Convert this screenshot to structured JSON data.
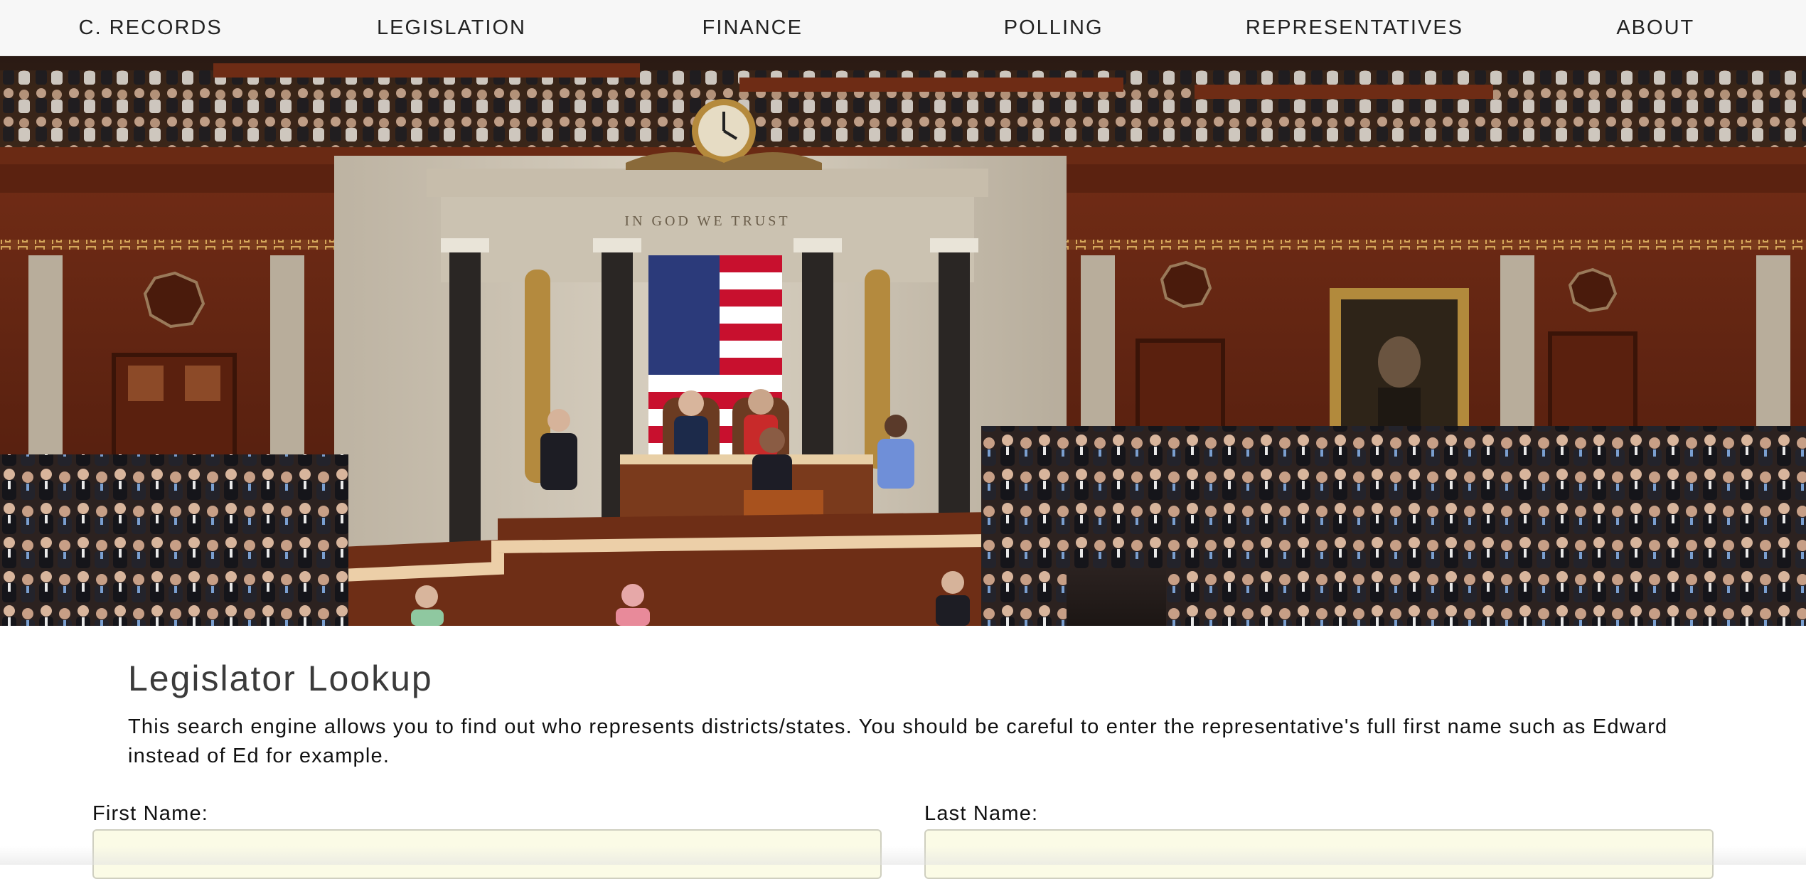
{
  "nav": {
    "items": [
      {
        "label": "C. RECORDS"
      },
      {
        "label": "LEGISLATION"
      },
      {
        "label": "FINANCE"
      },
      {
        "label": "POLLING"
      },
      {
        "label": "REPRESENTATIVES"
      },
      {
        "label": "ABOUT"
      }
    ]
  },
  "hero": {
    "inscription": "IN GOD WE TRUST"
  },
  "lookup": {
    "title": "Legislator Lookup",
    "description": "This search engine allows you to find out who represents districts/states. You should be careful to enter the representative's full first name such as Edward instead of Ed for example.",
    "first_name_label": "First Name:",
    "first_name_value": "",
    "last_name_label": "Last Name:",
    "last_name_value": ""
  },
  "colors": {
    "nav_bg": "#f7f7f7",
    "input_bg": "#fbfbe6",
    "wood": "#6b2a16",
    "marble": "#cfc7b8"
  }
}
